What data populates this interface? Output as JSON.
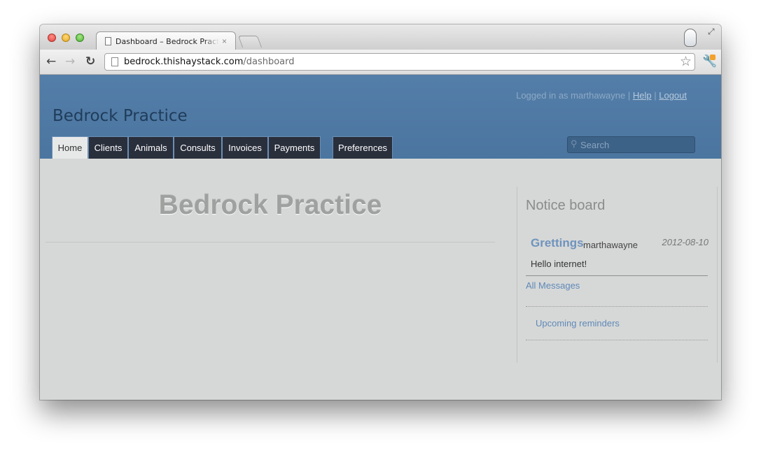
{
  "browser": {
    "tab_title": "Dashboard – Bedrock Practice",
    "tab_close": "×",
    "url_host": "bedrock.thishaystack.com",
    "url_path": "/dashboard"
  },
  "header": {
    "logged_in_text": "Logged in as marthawayne",
    "sep1": "|",
    "help": "Help",
    "sep2": "|",
    "logout": "Logout",
    "site_title": "Bedrock Practice",
    "search_placeholder": "Search"
  },
  "nav": {
    "items": [
      {
        "label": "Home",
        "active": true
      },
      {
        "label": "Clients"
      },
      {
        "label": "Animals"
      },
      {
        "label": "Consults"
      },
      {
        "label": "Invoices"
      },
      {
        "label": "Payments"
      },
      {
        "label": "Preferences"
      }
    ]
  },
  "main": {
    "heading": "Bedrock Practice"
  },
  "sidebar": {
    "title": "Notice board",
    "message": {
      "title": "Grettings",
      "author": "marthawayne",
      "date": "2012-08-10",
      "body": "Hello internet!"
    },
    "all_messages": "All Messages",
    "upcoming_reminders": "Upcoming reminders"
  },
  "colors": {
    "header_bg": "#4e7aa6",
    "nav_bg": "#2a2f3c",
    "link": "#5f89b8",
    "page_bg": "#d6d8d7"
  }
}
